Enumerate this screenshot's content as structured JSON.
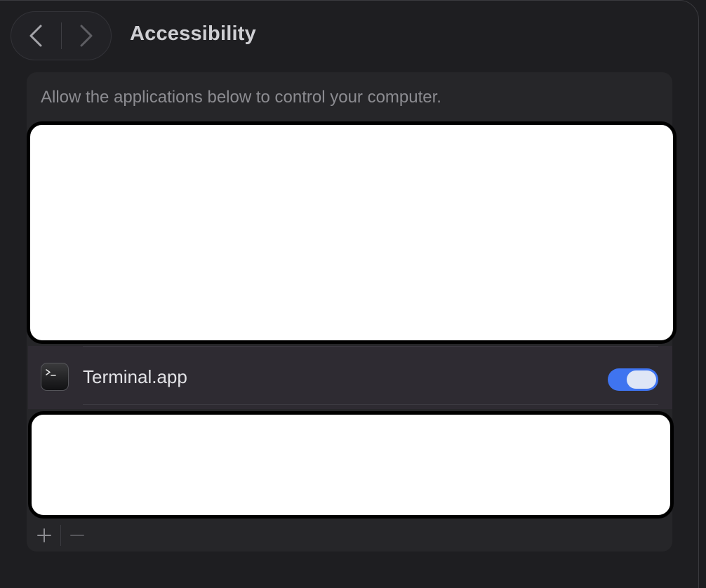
{
  "window": {
    "title": "Accessibility"
  },
  "navigation": {
    "back_icon": "chevron-left-icon",
    "forward_icon": "chevron-right-icon"
  },
  "main": {
    "description": "Allow the applications below to control your computer.",
    "apps": [
      {
        "name": "Terminal.app",
        "icon": "terminal-app-icon",
        "enabled": true
      }
    ]
  },
  "footer": {
    "add_icon": "plus-icon",
    "remove_icon": "minus-icon"
  },
  "colors": {
    "accent": "#3f74f0",
    "window_bg": "#1e1e21",
    "panel_bg": "#262629",
    "row_bg": "#2e2b32",
    "redaction": "#ffffff"
  }
}
